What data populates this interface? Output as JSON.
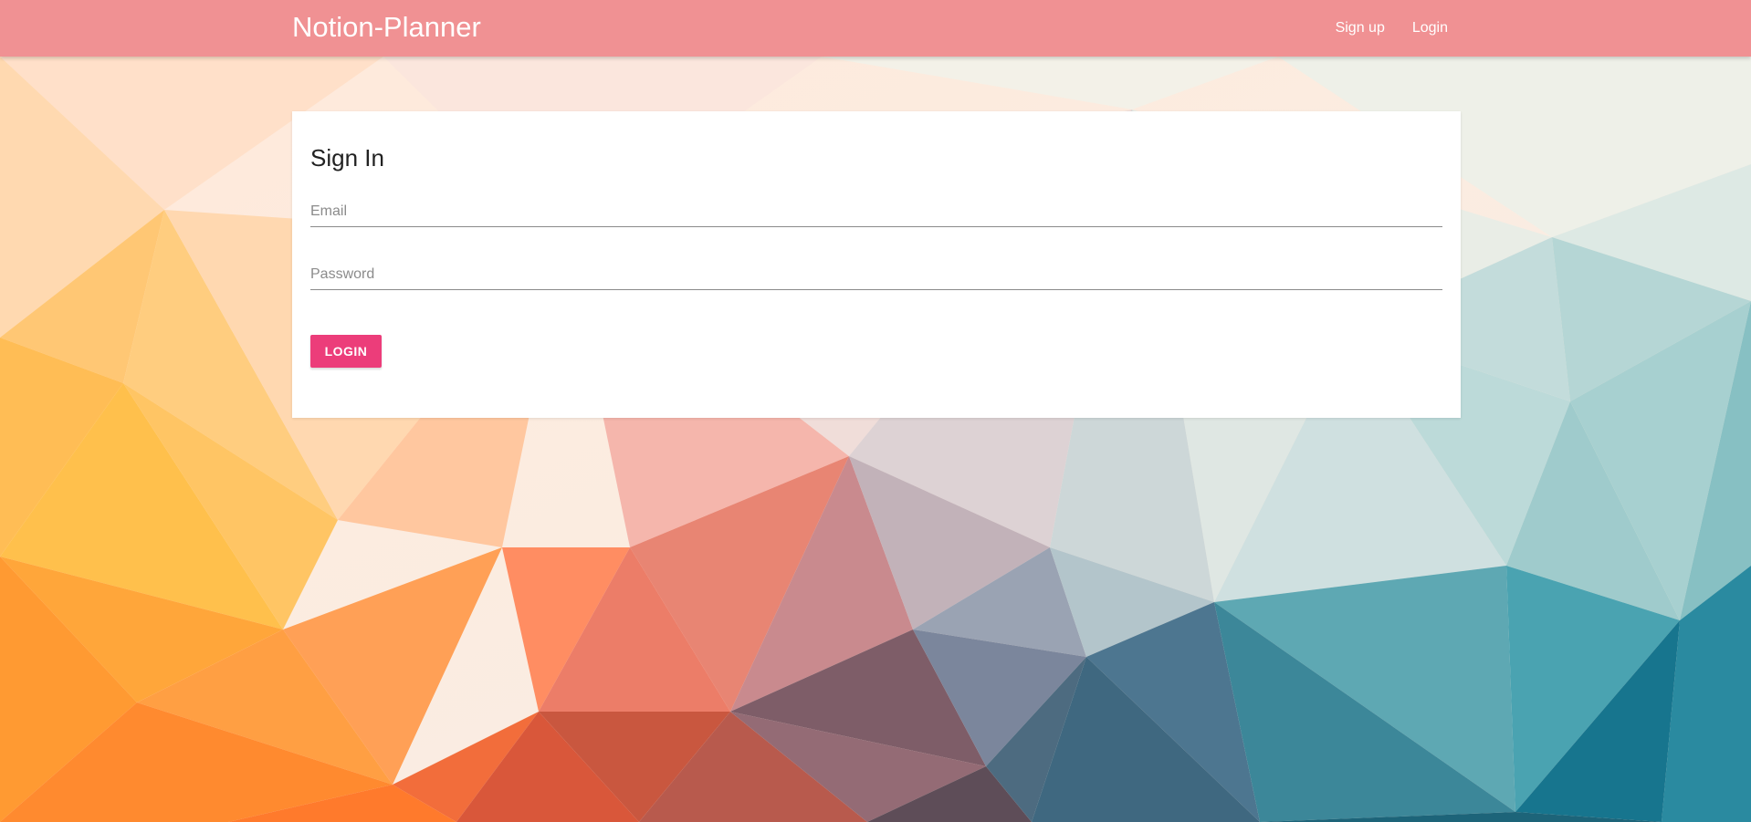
{
  "app": {
    "brand": "Notion-Planner"
  },
  "nav": {
    "links": [
      {
        "label": "Sign up"
      },
      {
        "label": "Login"
      }
    ]
  },
  "signin": {
    "title": "Sign In",
    "email_placeholder": "Email",
    "email_value": "",
    "password_placeholder": "Password",
    "password_value": "",
    "button_label": "LOGIN"
  },
  "colors": {
    "navbar": "#f09193",
    "button": "#ec3d7a",
    "card": "#ffffff"
  }
}
